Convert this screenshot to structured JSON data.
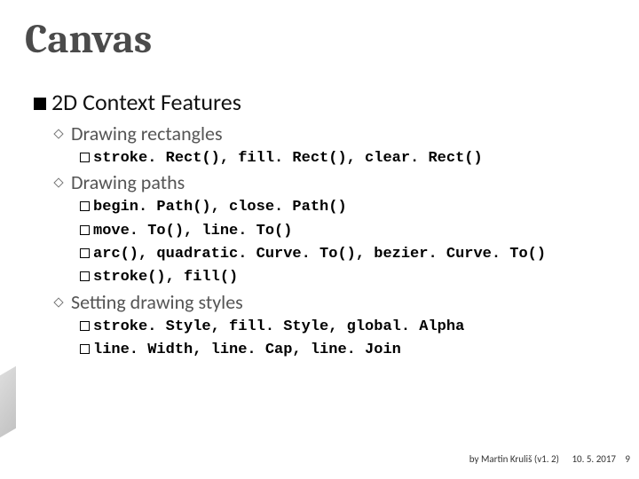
{
  "title": "Canvas",
  "section": {
    "bullet_label": "2D",
    "heading": "Context Features"
  },
  "items": [
    {
      "label": "Drawing rectangles",
      "code": [
        "stroke. Rect(), fill. Rect(), clear. Rect()"
      ]
    },
    {
      "label": "Drawing paths",
      "code": [
        "begin. Path(), close. Path()",
        "move. To(), line. To()",
        "arc(), quadratic. Curve. To(), bezier. Curve. To()",
        "stroke(), fill()"
      ]
    },
    {
      "label": "Setting drawing styles",
      "code": [
        "stroke. Style, fill. Style, global. Alpha",
        "line. Width, line. Cap, line. Join"
      ]
    }
  ],
  "footer": {
    "author": "by Martin Kruliš (v1. 2)",
    "date": "10. 5. 2017",
    "page": "9"
  }
}
